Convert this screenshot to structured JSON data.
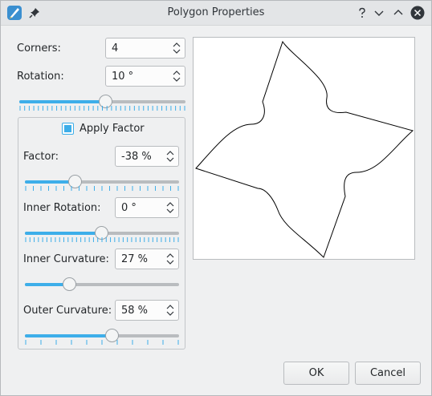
{
  "window": {
    "title": "Polygon Properties"
  },
  "fields": {
    "corners": {
      "label": "Corners:",
      "value": "4"
    },
    "rotation": {
      "label": "Rotation:",
      "value": "10 °",
      "slider_fraction": 0.52
    }
  },
  "factor_group": {
    "checkbox_label": "Apply Factor",
    "checked": true,
    "factor": {
      "label": "Factor:",
      "value": "-38 %",
      "slider_fraction": 0.33
    },
    "inner_rotation": {
      "label": "Inner Rotation:",
      "value": "0 °",
      "slider_fraction": 0.5
    },
    "inner_curvature": {
      "label": "Inner Curvature:",
      "value": "27 %",
      "slider_fraction": 0.29
    },
    "outer_curvature": {
      "label": "Outer Curvature:",
      "value": "58 %",
      "slider_fraction": 0.57
    }
  },
  "buttons": {
    "ok": "OK",
    "cancel": "Cancel"
  },
  "colors": {
    "accent": "#3daee9",
    "window_bg": "#eff0f1",
    "titlebar_bg": "#e3e5e7"
  },
  "icons": [
    "app-icon",
    "pin-icon",
    "help-icon",
    "minimize-icon",
    "maximize-icon",
    "close-icon",
    "spin-arrows-icon"
  ]
}
